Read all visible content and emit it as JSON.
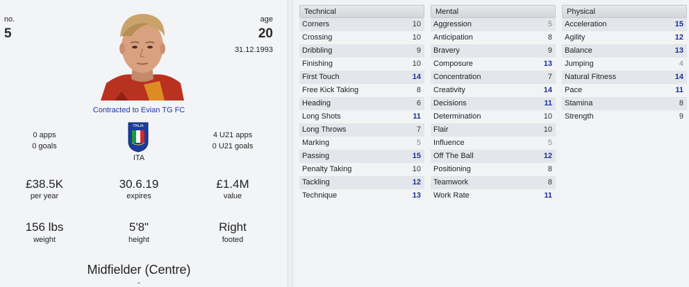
{
  "profile": {
    "no_label": "no.",
    "no_value": "5",
    "age_label": "age",
    "age_value": "20",
    "dob": "31.12.1993",
    "contract": "Contracted to Evian TG FC",
    "apps": "0 apps",
    "goals": "0 goals",
    "u21_apps": "4 U21 apps",
    "u21_goals": "0 U21 goals",
    "nation": "ITA",
    "flag_text": "ITALIA",
    "wage_value": "£38.5K",
    "wage_label": "per year",
    "expires_value": "30.6.19",
    "expires_label": "expires",
    "value_value": "£1.4M",
    "value_label": "value",
    "weight_value": "156 lbs",
    "weight_label": "weight",
    "height_value": "5'8\"",
    "height_label": "height",
    "footed_value": "Right",
    "footed_label": "footed",
    "position": "Midfielder (Centre)",
    "position_sub": "-"
  },
  "technical": {
    "title": "Technical",
    "rows": [
      {
        "name": "Corners",
        "value": "10"
      },
      {
        "name": "Crossing",
        "value": "10"
      },
      {
        "name": "Dribbling",
        "value": "9"
      },
      {
        "name": "Finishing",
        "value": "10"
      },
      {
        "name": "First Touch",
        "value": "14"
      },
      {
        "name": "Free Kick Taking",
        "value": "8"
      },
      {
        "name": "Heading",
        "value": "6"
      },
      {
        "name": "Long Shots",
        "value": "11"
      },
      {
        "name": "Long Throws",
        "value": "7"
      },
      {
        "name": "Marking",
        "value": "5"
      },
      {
        "name": "Passing",
        "value": "15"
      },
      {
        "name": "Penalty Taking",
        "value": "10"
      },
      {
        "name": "Tackling",
        "value": "12"
      },
      {
        "name": "Technique",
        "value": "13"
      }
    ]
  },
  "mental": {
    "title": "Mental",
    "rows": [
      {
        "name": "Aggression",
        "value": "5"
      },
      {
        "name": "Anticipation",
        "value": "8"
      },
      {
        "name": "Bravery",
        "value": "9"
      },
      {
        "name": "Composure",
        "value": "13"
      },
      {
        "name": "Concentration",
        "value": "7"
      },
      {
        "name": "Creativity",
        "value": "14"
      },
      {
        "name": "Decisions",
        "value": "11"
      },
      {
        "name": "Determination",
        "value": "10"
      },
      {
        "name": "Flair",
        "value": "10"
      },
      {
        "name": "Influence",
        "value": "5"
      },
      {
        "name": "Off The Ball",
        "value": "12"
      },
      {
        "name": "Positioning",
        "value": "8"
      },
      {
        "name": "Teamwork",
        "value": "8"
      },
      {
        "name": "Work Rate",
        "value": "11"
      }
    ]
  },
  "physical": {
    "title": "Physical",
    "rows": [
      {
        "name": "Acceleration",
        "value": "15"
      },
      {
        "name": "Agility",
        "value": "12"
      },
      {
        "name": "Balance",
        "value": "13"
      },
      {
        "name": "Jumping",
        "value": "4"
      },
      {
        "name": "Natural Fitness",
        "value": "14"
      },
      {
        "name": "Pace",
        "value": "11"
      },
      {
        "name": "Stamina",
        "value": "8"
      },
      {
        "name": "Strength",
        "value": "9"
      }
    ]
  },
  "colors": {
    "high": "#1a2f9e",
    "mid": "#333333",
    "low": "#888888",
    "contract_link": "#1c34a8"
  }
}
